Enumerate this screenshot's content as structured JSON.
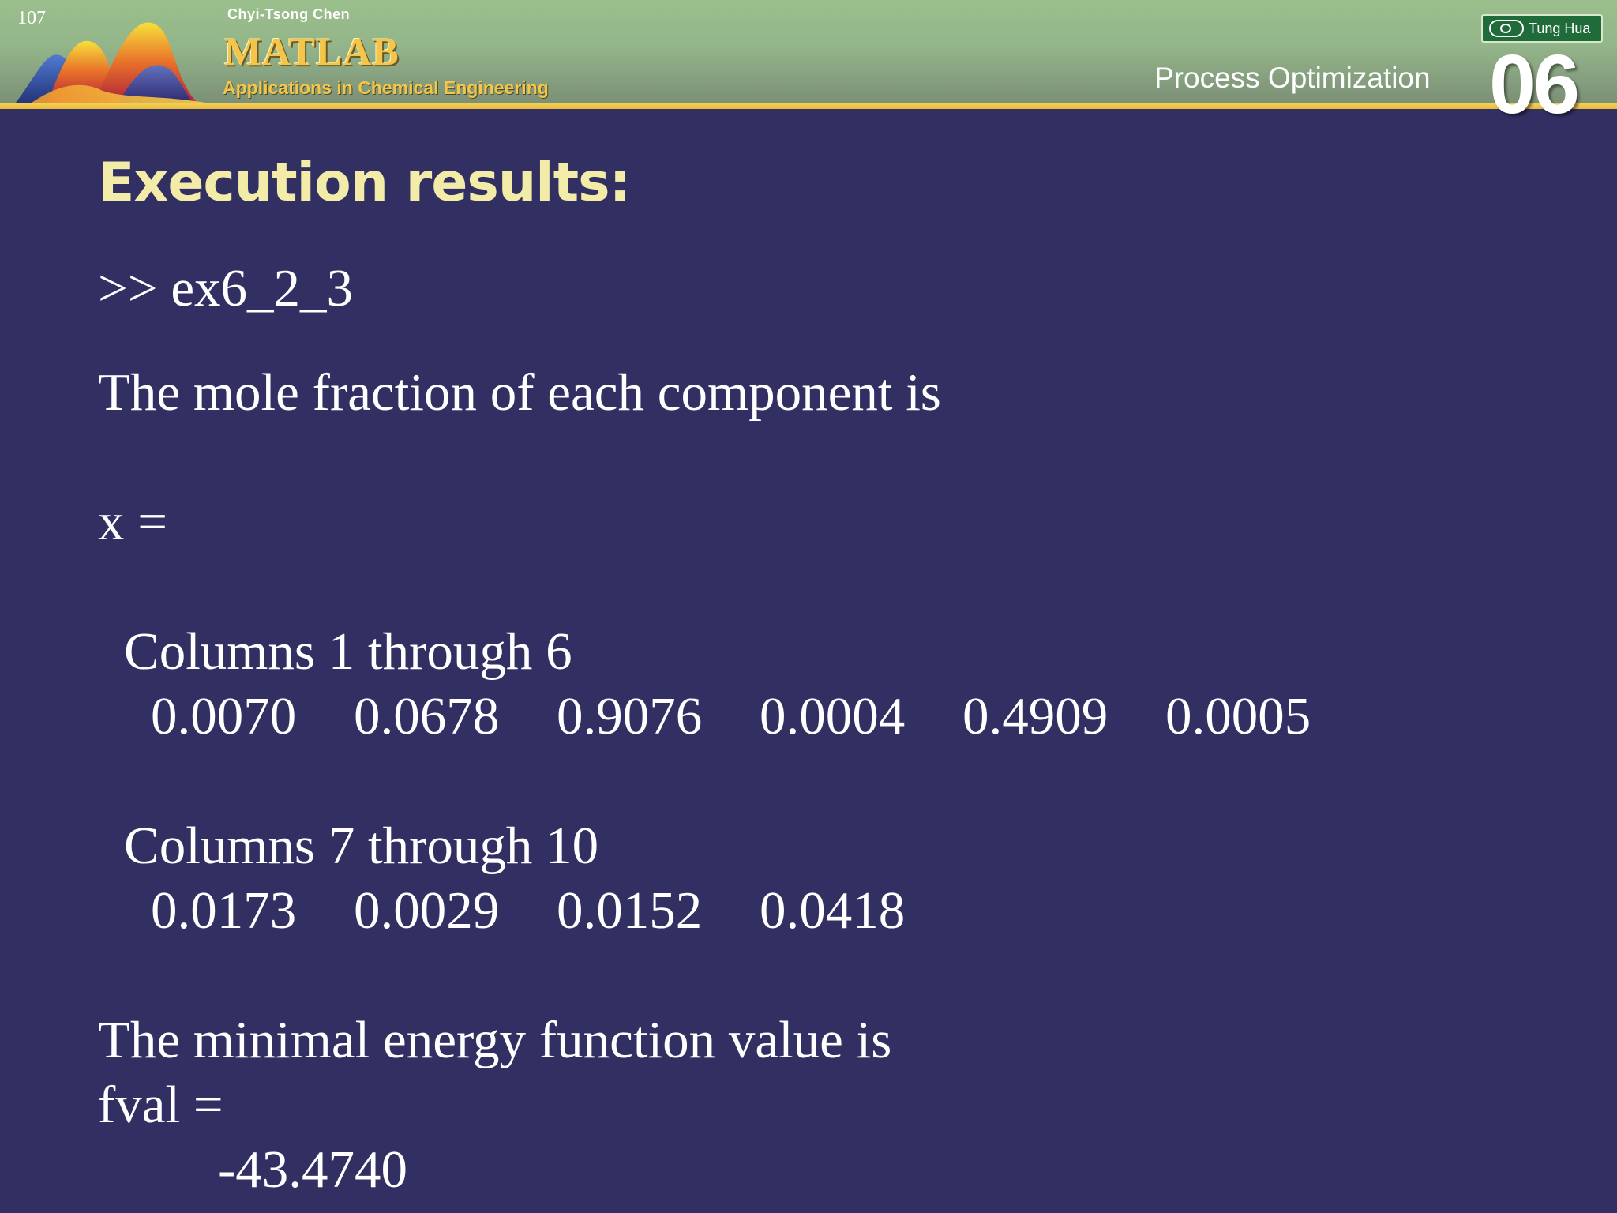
{
  "header": {
    "page_number": "107",
    "author": "Chyi-Tsong Chen",
    "book_title": "MATLAB",
    "book_subtitle": "Applications in Chemical Engineering",
    "publisher": "Tung Hua",
    "chapter_title": "Process Optimization",
    "chapter_number": "06",
    "colors": {
      "banner": "#93b58a",
      "stripe": "#f4d45a",
      "background": "#323063",
      "title": "#f3eba8"
    }
  },
  "slide": {
    "title": "Execution results:",
    "command": ">> ex6_2_3",
    "mole_fraction_text": "The mole fraction of each component is",
    "x_label": "x =",
    "block1": {
      "header": "Columns 1 through 6",
      "values": [
        "0.0070",
        "0.0678",
        "0.9076",
        "0.0004",
        "0.4909",
        "0.0005"
      ]
    },
    "block2": {
      "header": "Columns 7 through 10",
      "values": [
        "0.0173",
        "0.0029",
        "0.0152",
        "0.0418"
      ]
    },
    "energy_text": "The minimal energy function value is",
    "fval_label": "fval =",
    "fval_value": "-43.4740"
  }
}
